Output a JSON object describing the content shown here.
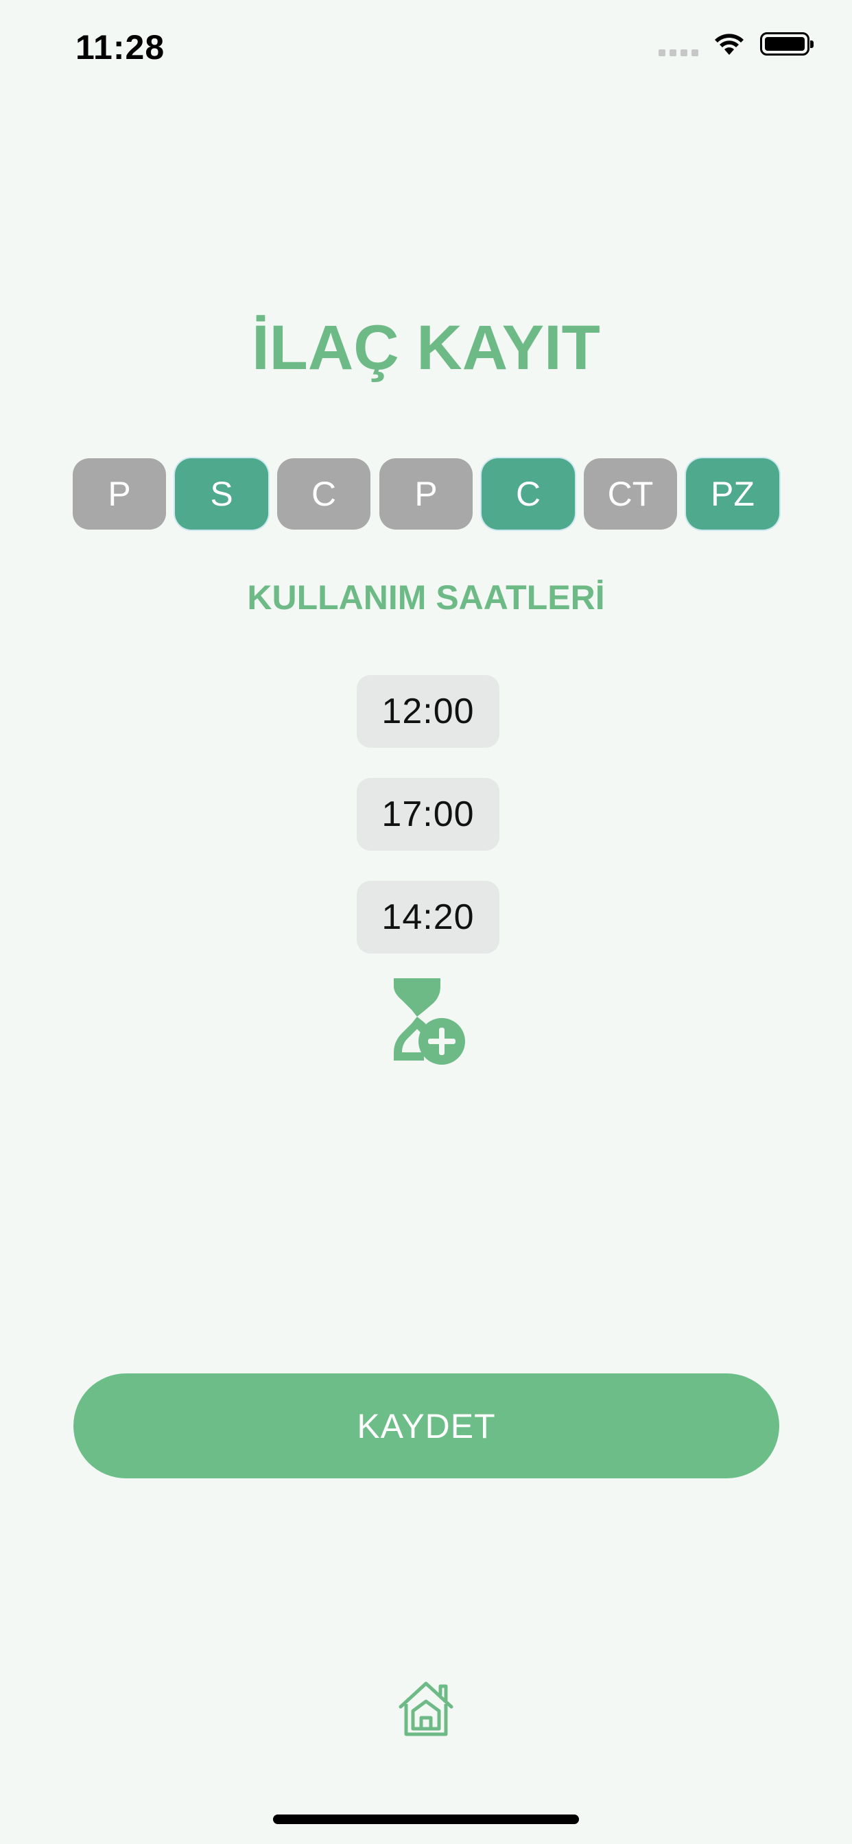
{
  "status_bar": {
    "time": "11:28"
  },
  "title": "İLAÇ KAYIT",
  "days": [
    {
      "label": "P",
      "selected": false
    },
    {
      "label": "S",
      "selected": true
    },
    {
      "label": "C",
      "selected": false
    },
    {
      "label": "P",
      "selected": false
    },
    {
      "label": "C",
      "selected": true
    },
    {
      "label": "CT",
      "selected": false
    },
    {
      "label": "PZ",
      "selected": true
    }
  ],
  "usage_times_title": "KULLANIM SAATLERİ",
  "times": [
    "12:00",
    "17:00",
    "14:20"
  ],
  "icons": {
    "add_time": "hourglass-plus-icon",
    "home": "home-icon"
  },
  "save_label": "KAYDET",
  "colors": {
    "accent": "#6dba87",
    "day_selected": "#4ea98d",
    "day_unselected": "#a8a8a8",
    "background": "#f3f8f4",
    "time_chip": "#e5e8e6"
  }
}
